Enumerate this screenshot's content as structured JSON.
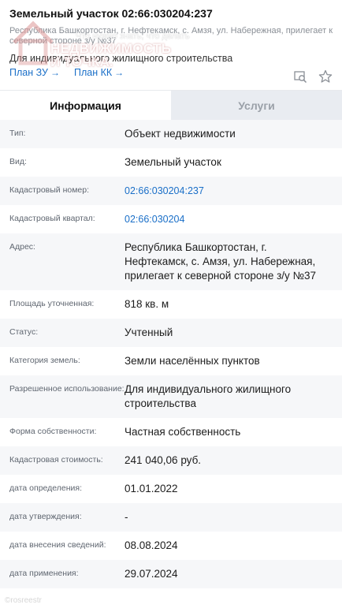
{
  "header": {
    "title": "Земельный участок 02:66:030204:237",
    "address_sub": "Республика Башкортостан, г. Нефтекамск, с. Амзя, ул. Набережная, прилегает к северной стороне з/у №37",
    "purpose": "Для индивидуального жилищного строительства",
    "links": [
      {
        "label": "План ЗУ",
        "arrow": "→"
      },
      {
        "label": "План КК",
        "arrow": "→"
      }
    ],
    "tools": {
      "search_icon": "map-search-icon",
      "star_icon": "star-icon"
    }
  },
  "watermark": {
    "small": "Что нужно знать, что делать",
    "line1": "НЕДВИЖИМОСТЬ",
    "line2": "И ТОЧКА."
  },
  "tabs": [
    {
      "label": "Информация",
      "active": true
    },
    {
      "label": "Услуги",
      "active": false
    }
  ],
  "rows": [
    {
      "label": "Тип:",
      "value": "Объект недвижимости"
    },
    {
      "label": "Вид:",
      "value": "Земельный участок"
    },
    {
      "label": "Кадастровый номер:",
      "value": "02:66:030204:237"
    },
    {
      "label": "Кадастровый квартал:",
      "value": "02:66:030204"
    },
    {
      "label": "Адрес:",
      "value": "Республика Башкортостан, г. Нефтекамск, с. Амзя, ул. Набережная, прилегает к северной стороне з/у №37"
    },
    {
      "label": "Площадь уточненная:",
      "value": "818 кв. м"
    },
    {
      "label": "Статус:",
      "value": "Учтенный"
    },
    {
      "label": "Категория земель:",
      "value": "Земли населённых пунктов"
    },
    {
      "label": "Разрешенное использование:",
      "value": "Для индивидуального жилищного строительства"
    },
    {
      "label": "Форма собственности:",
      "value": "Частная собственность"
    },
    {
      "label": "Кадастровая стоимость:",
      "value": "241 040,06 руб."
    },
    {
      "label": "дата определения:",
      "value": "01.01.2022"
    },
    {
      "label": "дата утверждения:",
      "value": "-"
    },
    {
      "label": "дата внесения сведений:",
      "value": "08.08.2024"
    },
    {
      "label": "дата применения:",
      "value": "29.07.2024"
    }
  ],
  "footer": {
    "mark": "©rosreestr"
  },
  "colors": {
    "link": "#1a6fc8",
    "tab_inactive_bg": "#e9ecf1",
    "row_alt_bg": "#f6f7f9"
  }
}
